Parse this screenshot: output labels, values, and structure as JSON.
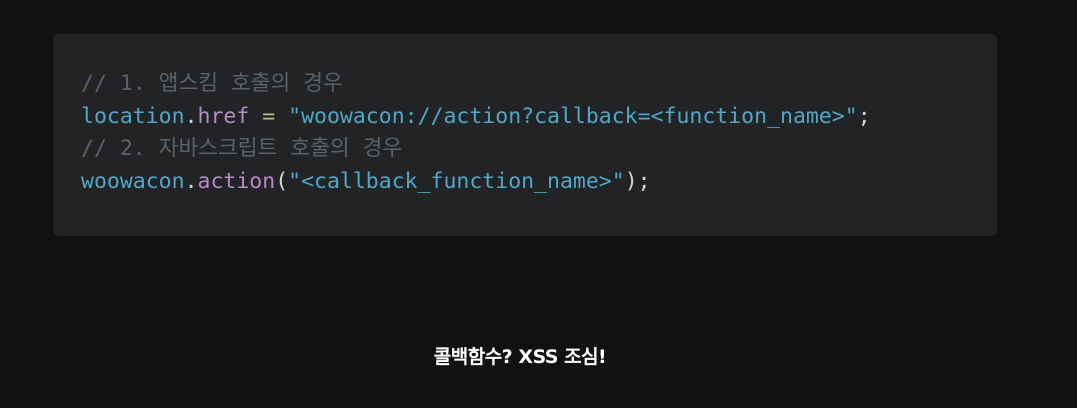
{
  "code_block": {
    "lines": [
      {
        "comment": "// 1. 앱스킴 호출의 경우"
      },
      {
        "object": "location",
        "dot": ".",
        "property": "href",
        "operator": " = ",
        "string": "\"woowacon://action?callback=<function_name>\"",
        "end": ";"
      },
      {
        "comment": "// 2. 자바스크립트 호출의 경우"
      },
      {
        "object": "woowacon",
        "dot": ".",
        "method": "action",
        "open_paren": "(",
        "string": "\"<callback_function_name>\"",
        "end": ");"
      }
    ]
  },
  "caption": "콜백함수? XSS 조심!",
  "colors": {
    "page_background": "#111112",
    "code_background": "#212325",
    "comment": "#5c6168",
    "identifier": "#4fa8c8",
    "property": "#b88ac6",
    "operator": "#b7c96a",
    "caption": "#ffffff"
  }
}
